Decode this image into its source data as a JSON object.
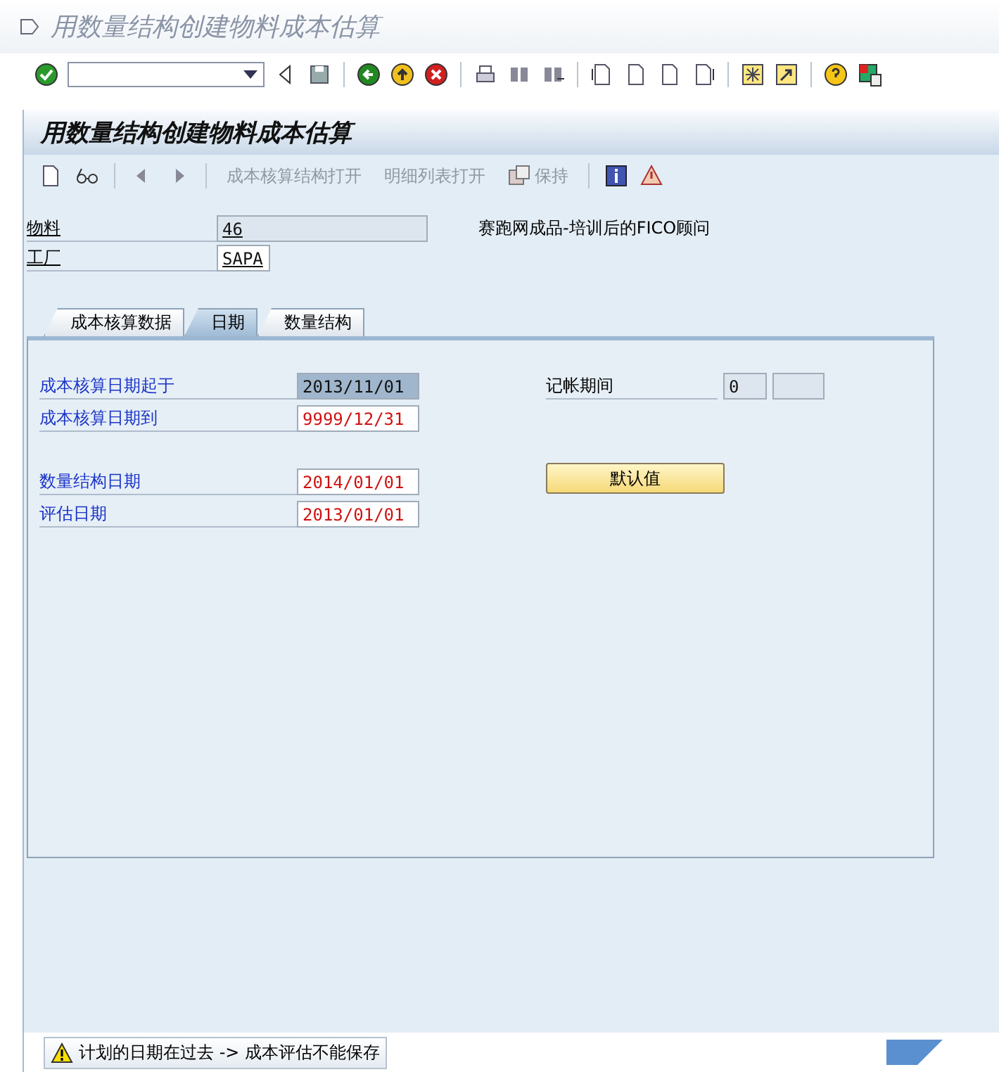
{
  "window": {
    "title": "用数量结构创建物料成本估算"
  },
  "screen": {
    "title": "用数量结构创建物料成本估算"
  },
  "app_toolbar": [
    {
      "label": "成本核算结构打开",
      "disabled": true
    },
    {
      "label": "明细列表打开",
      "disabled": true
    },
    {
      "label": "保持",
      "disabled": true
    }
  ],
  "header_fields": [
    {
      "label": "物料",
      "value": "46",
      "description": "赛跑网成品-培训后的FICO顾问"
    },
    {
      "label": "工厂",
      "value": "SAPA"
    }
  ],
  "tabs": [
    {
      "label": "成本核算数据",
      "selected": false
    },
    {
      "label": "日期",
      "selected": true
    },
    {
      "label": "数量结构",
      "selected": false
    }
  ],
  "date_fields": [
    {
      "label": "成本核算日期起于",
      "value": "2013/11/01",
      "selected": true,
      "error": false
    },
    {
      "label": "成本核算日期到",
      "value": "9999/12/31",
      "selected": false,
      "error": true
    },
    {
      "label": "数量结构日期",
      "value": "2014/01/01",
      "selected": false,
      "error": true
    },
    {
      "label": "评估日期",
      "value": "2013/01/01",
      "selected": false,
      "error": true
    }
  ],
  "posting_period": {
    "label": "记帐期间",
    "period": "0"
  },
  "default_button": {
    "label": "默认值"
  },
  "status_bar": {
    "message": "计划的日期在过去 -> 成本评估不能保存",
    "kind": "warning"
  }
}
